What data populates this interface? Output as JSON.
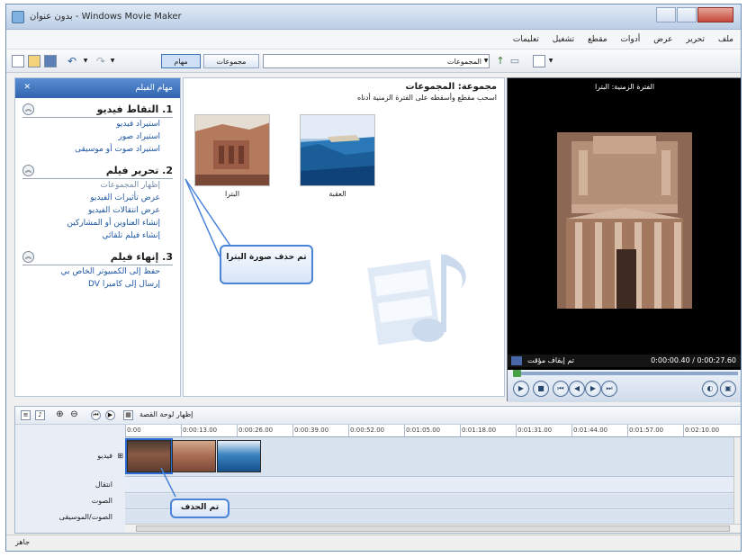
{
  "window": {
    "title": "بدون عنوان - Windows Movie Maker"
  },
  "menu": {
    "items": [
      "ملف",
      "تحرير",
      "عرض",
      "أدوات",
      "مقطع",
      "تشغيل",
      "تعليمات"
    ]
  },
  "toolbar": {
    "tasks_label": "مهام",
    "collections_label": "مجموعات",
    "collections_combo": "المجموعات"
  },
  "tasks": {
    "header": "مهام الفيلم",
    "sections": [
      {
        "title": "1. التقاط فيديو",
        "links": [
          "استيراد فيديو",
          "استيراد صور",
          "استيراد صوت أو موسيقى"
        ]
      },
      {
        "title": "2. تحرير فيلم",
        "links": [
          "إظهار المجموعات",
          "عرض تأثيرات الفيديو",
          "عرض انتقالات الفيديو",
          "إنشاء العناوين أو المشاركين",
          "إنشاء فيلم تلقائي"
        ]
      },
      {
        "title": "3. إنهاء فيلم",
        "links": [
          "حفظ إلى الكمبيوتر الخاص بي",
          "إرسال إلى كاميرا DV"
        ]
      }
    ]
  },
  "collection": {
    "title": "مجموعة: المجموعات",
    "subtitle": "اسحب مقطع وأسقطه على الفترة الزمنية أدناه",
    "items": [
      {
        "label": "البترا",
        "image": "petra-rock-facade"
      },
      {
        "label": "العقبة",
        "image": "aqaba-sea-coast"
      }
    ]
  },
  "callouts": {
    "top": "تم حذف صورة البترا",
    "bottom": "تم الحذف"
  },
  "preview": {
    "title": "الفترة الزمنية: البترا",
    "status_left": "تم إيقاف مؤقت",
    "time": "0:00:00.40 / 0:00:27.60"
  },
  "timeline": {
    "toggle_label": "إظهار لوحة القصة",
    "ruler": [
      "0:00",
      "0:00:13.00",
      "0:00:26.00",
      "0:00:39.00",
      "0:00:52.00",
      "0:01:05.00",
      "0:01:18.00",
      "0:01:31.00",
      "0:01:44.00",
      "0:01:57.00",
      "0:02:10.00"
    ],
    "tracks": [
      "فيديو",
      "انتقال",
      "الصوت",
      "الصوت/الموسيقى"
    ]
  },
  "status": {
    "text": "جاهز"
  },
  "colors": {
    "task_header": "#2f63ad",
    "link": "#1f57a3",
    "callout_border": "#4a84d8"
  }
}
